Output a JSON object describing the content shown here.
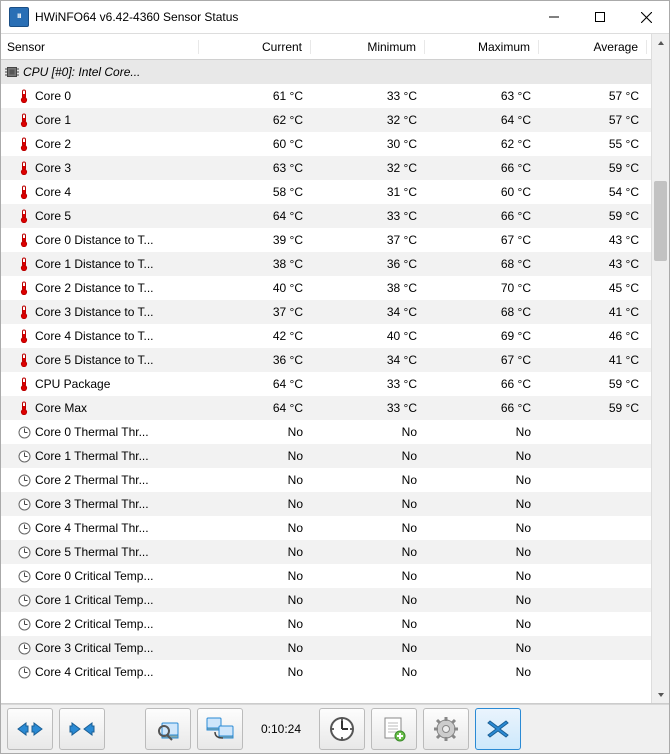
{
  "window": {
    "title": "HWiNFO64 v6.42-4360 Sensor Status",
    "app_icon_label": "HW"
  },
  "columns": {
    "sensor": "Sensor",
    "current": "Current",
    "minimum": "Minimum",
    "maximum": "Maximum",
    "average": "Average"
  },
  "section": {
    "label": "CPU [#0]: Intel Core..."
  },
  "rows": [
    {
      "icon": "temp",
      "label": "Core 0",
      "cur": "61 °C",
      "min": "33 °C",
      "max": "63 °C",
      "avg": "57 °C"
    },
    {
      "icon": "temp",
      "label": "Core 1",
      "cur": "62 °C",
      "min": "32 °C",
      "max": "64 °C",
      "avg": "57 °C"
    },
    {
      "icon": "temp",
      "label": "Core 2",
      "cur": "60 °C",
      "min": "30 °C",
      "max": "62 °C",
      "avg": "55 °C"
    },
    {
      "icon": "temp",
      "label": "Core 3",
      "cur": "63 °C",
      "min": "32 °C",
      "max": "66 °C",
      "avg": "59 °C"
    },
    {
      "icon": "temp",
      "label": "Core 4",
      "cur": "58 °C",
      "min": "31 °C",
      "max": "60 °C",
      "avg": "54 °C"
    },
    {
      "icon": "temp",
      "label": "Core 5",
      "cur": "64 °C",
      "min": "33 °C",
      "max": "66 °C",
      "avg": "59 °C"
    },
    {
      "icon": "temp",
      "label": "Core 0 Distance to T...",
      "cur": "39 °C",
      "min": "37 °C",
      "max": "67 °C",
      "avg": "43 °C"
    },
    {
      "icon": "temp",
      "label": "Core 1 Distance to T...",
      "cur": "38 °C",
      "min": "36 °C",
      "max": "68 °C",
      "avg": "43 °C"
    },
    {
      "icon": "temp",
      "label": "Core 2 Distance to T...",
      "cur": "40 °C",
      "min": "38 °C",
      "max": "70 °C",
      "avg": "45 °C"
    },
    {
      "icon": "temp",
      "label": "Core 3 Distance to T...",
      "cur": "37 °C",
      "min": "34 °C",
      "max": "68 °C",
      "avg": "41 °C"
    },
    {
      "icon": "temp",
      "label": "Core 4 Distance to T...",
      "cur": "42 °C",
      "min": "40 °C",
      "max": "69 °C",
      "avg": "46 °C"
    },
    {
      "icon": "temp",
      "label": "Core 5 Distance to T...",
      "cur": "36 °C",
      "min": "34 °C",
      "max": "67 °C",
      "avg": "41 °C"
    },
    {
      "icon": "temp",
      "label": "CPU Package",
      "cur": "64 °C",
      "min": "33 °C",
      "max": "66 °C",
      "avg": "59 °C"
    },
    {
      "icon": "temp",
      "label": "Core Max",
      "cur": "64 °C",
      "min": "33 °C",
      "max": "66 °C",
      "avg": "59 °C"
    },
    {
      "icon": "clock",
      "label": "Core 0 Thermal Thr...",
      "cur": "No",
      "min": "No",
      "max": "No",
      "avg": ""
    },
    {
      "icon": "clock",
      "label": "Core 1 Thermal Thr...",
      "cur": "No",
      "min": "No",
      "max": "No",
      "avg": ""
    },
    {
      "icon": "clock",
      "label": "Core 2 Thermal Thr...",
      "cur": "No",
      "min": "No",
      "max": "No",
      "avg": ""
    },
    {
      "icon": "clock",
      "label": "Core 3 Thermal Thr...",
      "cur": "No",
      "min": "No",
      "max": "No",
      "avg": ""
    },
    {
      "icon": "clock",
      "label": "Core 4 Thermal Thr...",
      "cur": "No",
      "min": "No",
      "max": "No",
      "avg": ""
    },
    {
      "icon": "clock",
      "label": "Core 5 Thermal Thr...",
      "cur": "No",
      "min": "No",
      "max": "No",
      "avg": ""
    },
    {
      "icon": "clock",
      "label": "Core 0 Critical Temp...",
      "cur": "No",
      "min": "No",
      "max": "No",
      "avg": ""
    },
    {
      "icon": "clock",
      "label": "Core 1 Critical Temp...",
      "cur": "No",
      "min": "No",
      "max": "No",
      "avg": ""
    },
    {
      "icon": "clock",
      "label": "Core 2 Critical Temp...",
      "cur": "No",
      "min": "No",
      "max": "No",
      "avg": ""
    },
    {
      "icon": "clock",
      "label": "Core 3 Critical Temp...",
      "cur": "No",
      "min": "No",
      "max": "No",
      "avg": ""
    },
    {
      "icon": "clock",
      "label": "Core 4 Critical Temp...",
      "cur": "No",
      "min": "No",
      "max": "No",
      "avg": ""
    }
  ],
  "toolbar": {
    "elapsed": "0:10:24"
  }
}
